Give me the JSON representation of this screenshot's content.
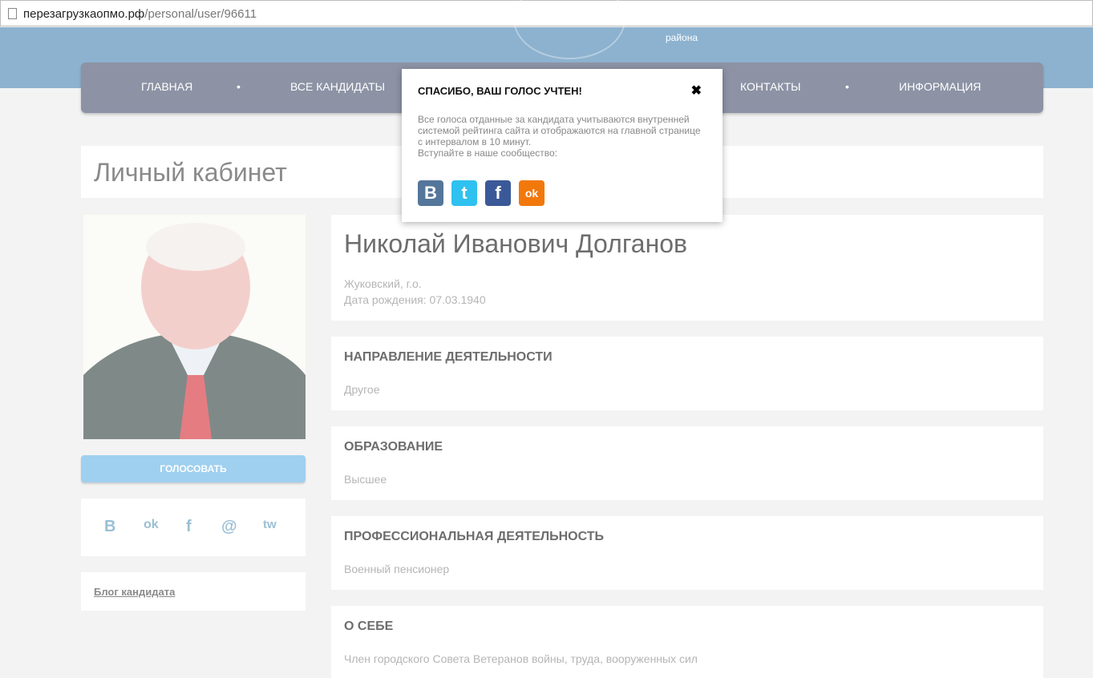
{
  "browser": {
    "url_host": "перезагрузкаопмо.рф",
    "url_path": "/personal/user/96611"
  },
  "header": {
    "rayona": "района"
  },
  "nav": {
    "items": [
      "ГЛАВНАЯ",
      "ВСЕ КАНДИДАТЫ",
      "КОНТАКТЫ",
      "ИНФОРМАЦИЯ"
    ],
    "dot": "•"
  },
  "page_title": "Личный кабинет",
  "sidebar": {
    "vote_label": "ГОЛОСОВАТЬ",
    "share": [
      "B",
      "ok",
      "f",
      "@",
      "tw"
    ],
    "blog_label": "Блог кандидата"
  },
  "profile": {
    "name": "Николай Иванович Долганов",
    "city": "Жуковский, г.о.",
    "birth": "Дата рождения: 07.03.1940"
  },
  "sections": [
    {
      "title": "НАПРАВЛЕНИЕ ДЕЯТЕЛЬНОСТИ",
      "value": "Другое"
    },
    {
      "title": "ОБРАЗОВАНИЕ",
      "value": "Высшее"
    },
    {
      "title": "ПРОФЕССИОНАЛЬНАЯ ДЕЯТЕЛЬНОСТЬ",
      "value": "Военный пенсионер"
    },
    {
      "title": "О СЕБЕ",
      "value": "Член городского Совета Ветеранов войны, труда, вооруженных сил"
    }
  ],
  "modal": {
    "title": "СПАСИБО, ВАШ ГОЛОС УЧТЕН!",
    "close": "✖",
    "text": "Все голоса отданные за кандидата учитываются внутренней системой рейтинга сайта и отображаются на главной странице с интервалом в 10 минут.",
    "join": "Вступайте в наше сообщество:",
    "socials": [
      {
        "label": "B",
        "color": "#54769a"
      },
      {
        "label": "t",
        "color": "#2fc1ef"
      },
      {
        "label": "f",
        "color": "#3b5998"
      },
      {
        "label": "ok",
        "color": "#f2780c"
      }
    ]
  }
}
